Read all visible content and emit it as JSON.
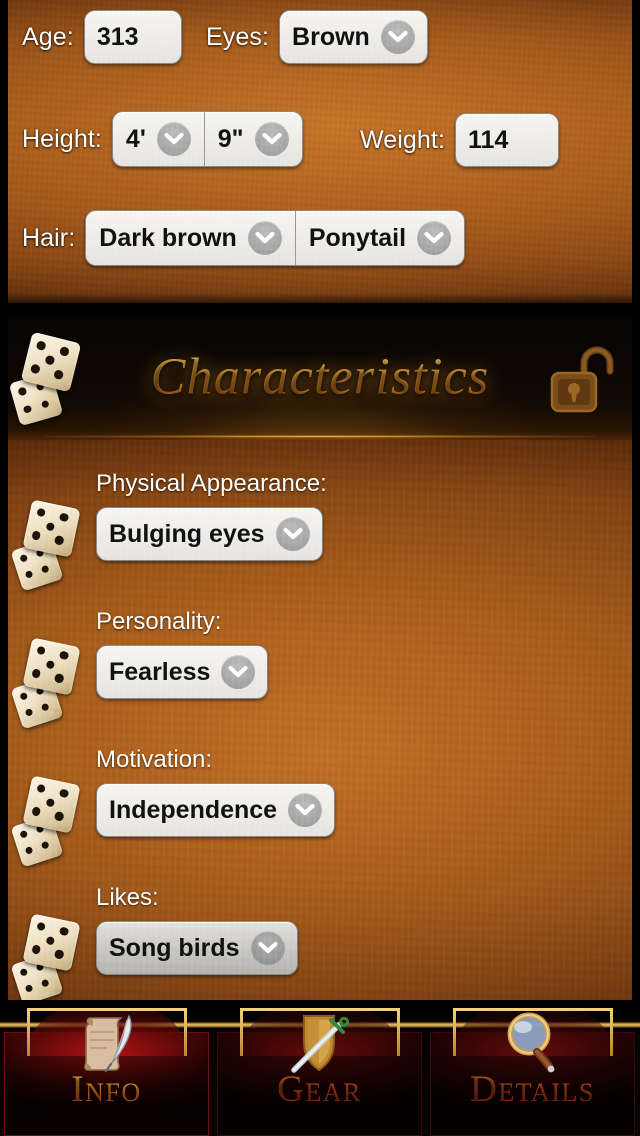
{
  "top_form": {
    "fields": [
      {
        "label": "Age:",
        "kind": "text",
        "value": "313"
      },
      {
        "label": "Eyes:",
        "kind": "dropdown",
        "value": "Brown"
      },
      {
        "label": "Height:",
        "kind": "segmented",
        "value_feet": "4'",
        "value_inches": "9\""
      },
      {
        "label": "Weight:",
        "kind": "text",
        "value": "114"
      },
      {
        "label": "Hair:",
        "kind": "segmented",
        "value_color": "Dark brown",
        "value_style": "Ponytail"
      }
    ]
  },
  "section": {
    "title": "Characteristics",
    "dice_icon": "dice-icon",
    "lock_icon": "open-padlock-icon",
    "title_color": "#eda72e"
  },
  "characteristics": [
    {
      "label": "Physical Appearance:",
      "value": "Bulging eyes",
      "dice_icon": "dice-icon",
      "pressed": false
    },
    {
      "label": "Personality:",
      "value": "Fearless",
      "dice_icon": "dice-icon",
      "pressed": false
    },
    {
      "label": "Motivation:",
      "value": "Independence",
      "dice_icon": "dice-icon",
      "pressed": false
    },
    {
      "label": "Likes:",
      "value": "Song birds",
      "dice_icon": "dice-icon",
      "pressed": true
    }
  ],
  "tabbar": {
    "tabs": [
      {
        "label": "Info",
        "icon": "scroll-quill-icon",
        "active": true
      },
      {
        "label": "Gear",
        "icon": "sword-shield-icon",
        "active": false
      },
      {
        "label": "Details",
        "icon": "magnifier-icon",
        "active": false
      }
    ]
  },
  "colors": {
    "panel_brown": "#a85f1c",
    "header_black": "#0c0704",
    "gold": "#eda72e",
    "tab_red": "#960e0e",
    "pill_white": "#efedea"
  }
}
